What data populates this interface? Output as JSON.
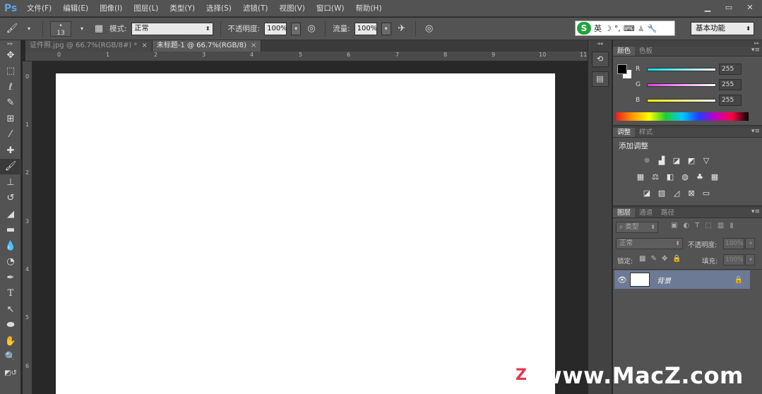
{
  "app": {
    "logo": "Ps"
  },
  "menu": [
    "文件(F)",
    "编辑(E)",
    "图像(I)",
    "图层(L)",
    "类型(Y)",
    "选择(S)",
    "滤镜(T)",
    "视图(V)",
    "窗口(W)",
    "帮助(H)"
  ],
  "window_controls": [
    "minimize-icon",
    "restore-icon",
    "close-icon"
  ],
  "options": {
    "brush_size": "13",
    "mode_label": "模式:",
    "mode_value": "正常",
    "opacity_label": "不透明度:",
    "opacity_value": "100%",
    "flow_label": "流量:",
    "flow_value": "100%",
    "workspace": "基本功能"
  },
  "ime": {
    "logo": "S",
    "lang": "英"
  },
  "tabs": [
    {
      "label": "证件照.jpg @ 66.7%(RGB/8#) *",
      "active": false
    },
    {
      "label": "未标题-1 @ 66.7%(RGB/8)",
      "active": true
    }
  ],
  "ruler_top": [
    "0",
    "1",
    "2",
    "3",
    "4",
    "5",
    "6",
    "7",
    "8",
    "9",
    "10",
    "11"
  ],
  "ruler_left": [
    "0",
    "1",
    "2",
    "3",
    "4",
    "5",
    "6"
  ],
  "tools": [
    "move-tool-icon",
    "marquee-tool-icon",
    "lasso-tool-icon",
    "quick-select-tool-icon",
    "crop-tool-icon",
    "eyedropper-tool-icon",
    "healing-brush-tool-icon",
    "brush-tool-icon",
    "clone-stamp-tool-icon",
    "history-brush-tool-icon",
    "eraser-tool-icon",
    "gradient-tool-icon",
    "blur-tool-icon",
    "dodge-tool-icon",
    "pen-tool-icon",
    "type-tool-icon",
    "path-select-tool-icon",
    "ellipse-tool-icon",
    "hand-tool-icon",
    "zoom-tool-icon"
  ],
  "color_panel": {
    "tabs": [
      "颜色",
      "色板"
    ],
    "foreground": "#000000",
    "background": "#ffffff",
    "channels": [
      {
        "label": "R",
        "value": "255",
        "color": "#00e5ff"
      },
      {
        "label": "G",
        "value": "255",
        "color": "#e040e0"
      },
      {
        "label": "B",
        "value": "255",
        "color": "#ffff00"
      }
    ]
  },
  "adjust_panel": {
    "tabs": [
      "调整",
      "样式"
    ],
    "title": "添加调整"
  },
  "layers_panel": {
    "tabs": [
      "图层",
      "通道",
      "路径"
    ],
    "filter_label": "类型",
    "blend_mode": "正常",
    "opacity_label": "不透明度:",
    "opacity_value": "100%",
    "lock_label": "锁定:",
    "fill_label": "填充:",
    "fill_value": "100%",
    "layers": [
      {
        "name": "背景",
        "selected": true
      }
    ]
  },
  "watermark": {
    "logo": "Z",
    "text": "www.MacZ.com"
  }
}
